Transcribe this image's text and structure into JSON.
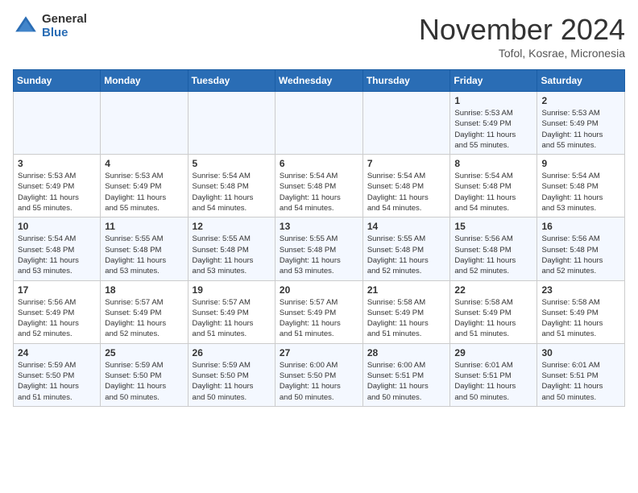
{
  "header": {
    "logo": {
      "general": "General",
      "blue": "Blue"
    },
    "title": "November 2024",
    "location": "Tofol, Kosrae, Micronesia"
  },
  "columns": [
    "Sunday",
    "Monday",
    "Tuesday",
    "Wednesday",
    "Thursday",
    "Friday",
    "Saturday"
  ],
  "weeks": [
    [
      {
        "day": "",
        "info": ""
      },
      {
        "day": "",
        "info": ""
      },
      {
        "day": "",
        "info": ""
      },
      {
        "day": "",
        "info": ""
      },
      {
        "day": "",
        "info": ""
      },
      {
        "day": "1",
        "info": "Sunrise: 5:53 AM\nSunset: 5:49 PM\nDaylight: 11 hours\nand 55 minutes."
      },
      {
        "day": "2",
        "info": "Sunrise: 5:53 AM\nSunset: 5:49 PM\nDaylight: 11 hours\nand 55 minutes."
      }
    ],
    [
      {
        "day": "3",
        "info": "Sunrise: 5:53 AM\nSunset: 5:49 PM\nDaylight: 11 hours\nand 55 minutes."
      },
      {
        "day": "4",
        "info": "Sunrise: 5:53 AM\nSunset: 5:49 PM\nDaylight: 11 hours\nand 55 minutes."
      },
      {
        "day": "5",
        "info": "Sunrise: 5:54 AM\nSunset: 5:48 PM\nDaylight: 11 hours\nand 54 minutes."
      },
      {
        "day": "6",
        "info": "Sunrise: 5:54 AM\nSunset: 5:48 PM\nDaylight: 11 hours\nand 54 minutes."
      },
      {
        "day": "7",
        "info": "Sunrise: 5:54 AM\nSunset: 5:48 PM\nDaylight: 11 hours\nand 54 minutes."
      },
      {
        "day": "8",
        "info": "Sunrise: 5:54 AM\nSunset: 5:48 PM\nDaylight: 11 hours\nand 54 minutes."
      },
      {
        "day": "9",
        "info": "Sunrise: 5:54 AM\nSunset: 5:48 PM\nDaylight: 11 hours\nand 53 minutes."
      }
    ],
    [
      {
        "day": "10",
        "info": "Sunrise: 5:54 AM\nSunset: 5:48 PM\nDaylight: 11 hours\nand 53 minutes."
      },
      {
        "day": "11",
        "info": "Sunrise: 5:55 AM\nSunset: 5:48 PM\nDaylight: 11 hours\nand 53 minutes."
      },
      {
        "day": "12",
        "info": "Sunrise: 5:55 AM\nSunset: 5:48 PM\nDaylight: 11 hours\nand 53 minutes."
      },
      {
        "day": "13",
        "info": "Sunrise: 5:55 AM\nSunset: 5:48 PM\nDaylight: 11 hours\nand 53 minutes."
      },
      {
        "day": "14",
        "info": "Sunrise: 5:55 AM\nSunset: 5:48 PM\nDaylight: 11 hours\nand 52 minutes."
      },
      {
        "day": "15",
        "info": "Sunrise: 5:56 AM\nSunset: 5:48 PM\nDaylight: 11 hours\nand 52 minutes."
      },
      {
        "day": "16",
        "info": "Sunrise: 5:56 AM\nSunset: 5:48 PM\nDaylight: 11 hours\nand 52 minutes."
      }
    ],
    [
      {
        "day": "17",
        "info": "Sunrise: 5:56 AM\nSunset: 5:49 PM\nDaylight: 11 hours\nand 52 minutes."
      },
      {
        "day": "18",
        "info": "Sunrise: 5:57 AM\nSunset: 5:49 PM\nDaylight: 11 hours\nand 52 minutes."
      },
      {
        "day": "19",
        "info": "Sunrise: 5:57 AM\nSunset: 5:49 PM\nDaylight: 11 hours\nand 51 minutes."
      },
      {
        "day": "20",
        "info": "Sunrise: 5:57 AM\nSunset: 5:49 PM\nDaylight: 11 hours\nand 51 minutes."
      },
      {
        "day": "21",
        "info": "Sunrise: 5:58 AM\nSunset: 5:49 PM\nDaylight: 11 hours\nand 51 minutes."
      },
      {
        "day": "22",
        "info": "Sunrise: 5:58 AM\nSunset: 5:49 PM\nDaylight: 11 hours\nand 51 minutes."
      },
      {
        "day": "23",
        "info": "Sunrise: 5:58 AM\nSunset: 5:49 PM\nDaylight: 11 hours\nand 51 minutes."
      }
    ],
    [
      {
        "day": "24",
        "info": "Sunrise: 5:59 AM\nSunset: 5:50 PM\nDaylight: 11 hours\nand 51 minutes."
      },
      {
        "day": "25",
        "info": "Sunrise: 5:59 AM\nSunset: 5:50 PM\nDaylight: 11 hours\nand 50 minutes."
      },
      {
        "day": "26",
        "info": "Sunrise: 5:59 AM\nSunset: 5:50 PM\nDaylight: 11 hours\nand 50 minutes."
      },
      {
        "day": "27",
        "info": "Sunrise: 6:00 AM\nSunset: 5:50 PM\nDaylight: 11 hours\nand 50 minutes."
      },
      {
        "day": "28",
        "info": "Sunrise: 6:00 AM\nSunset: 5:51 PM\nDaylight: 11 hours\nand 50 minutes."
      },
      {
        "day": "29",
        "info": "Sunrise: 6:01 AM\nSunset: 5:51 PM\nDaylight: 11 hours\nand 50 minutes."
      },
      {
        "day": "30",
        "info": "Sunrise: 6:01 AM\nSunset: 5:51 PM\nDaylight: 11 hours\nand 50 minutes."
      }
    ]
  ]
}
